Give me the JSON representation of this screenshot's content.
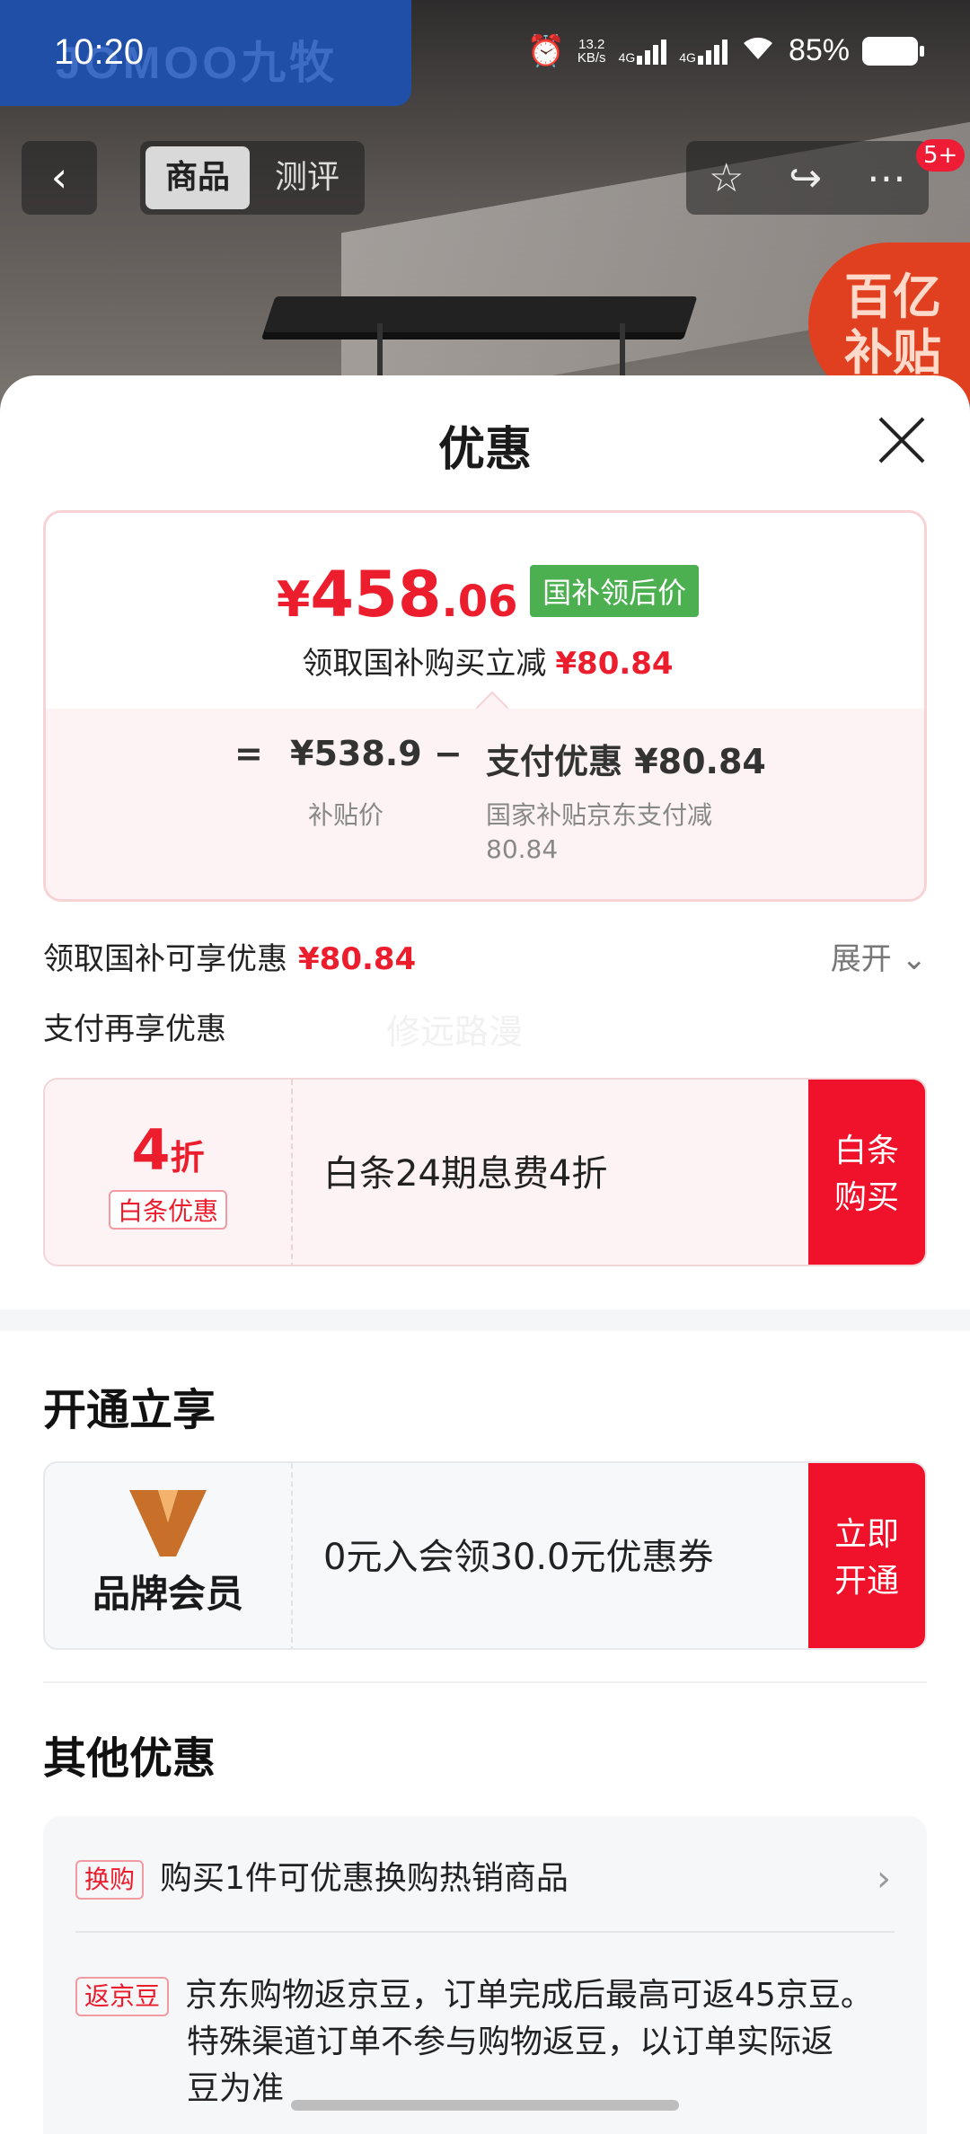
{
  "status_bar": {
    "time": "10:20",
    "net_speed": "13.2",
    "net_unit": "KB/s",
    "sig1": "4G",
    "sig2": "4G",
    "battery": "85%"
  },
  "hero": {
    "brand": "JOMOO九牧",
    "subsidy_badge_line1": "百亿",
    "subsidy_badge_line2": "补贴"
  },
  "nav": {
    "tabs": [
      "商品",
      "测评"
    ],
    "badge": "5+"
  },
  "sheet": {
    "title": "优惠",
    "price": {
      "currency": "¥",
      "integer": "458",
      "decimal": ".06",
      "tag": "国补领后价",
      "subtitle": "领取国补购买立减",
      "subtitle_amount": "¥80.84",
      "breakdown": {
        "eq": "=",
        "base_price": "¥538.9",
        "minus": "−",
        "discount_label": "支付优惠 ¥80.84",
        "base_label": "补贴价",
        "discount_desc_line1": "国家补贴京东支付减",
        "discount_desc_line2": "80.84"
      }
    },
    "subsidy_row": {
      "label": "领取国补可享优惠",
      "amount": "¥80.84",
      "expand": "展开"
    },
    "pay_row": {
      "label": "支付再享优惠"
    },
    "watermark": "修远路漫",
    "baitiao": {
      "discount_num": "4",
      "discount_unit": "折",
      "tag": "白条优惠",
      "text": "白条24期息费4折",
      "cta_line1": "白条",
      "cta_line2": "购买"
    },
    "open_section": {
      "title": "开通立享"
    },
    "member": {
      "label": "品牌会员",
      "text": "0元入会领30.0元优惠券",
      "cta_line1": "立即",
      "cta_line2": "开通"
    },
    "other_section": {
      "title": "其他优惠",
      "items": [
        {
          "tag": "换购",
          "text": "购买1件可优惠换购热销商品"
        },
        {
          "tag": "返京豆",
          "text_line1": "京东购物返京豆，订单完成后最高可返45京豆。",
          "text_line2": "特殊渠道订单不参与购物返豆，以订单实际返",
          "text_line3": "豆为准"
        }
      ]
    }
  },
  "colors": {
    "accent_red": "#ec1d2c",
    "cta_red": "#f0112b",
    "tag_green": "#4caf50"
  }
}
